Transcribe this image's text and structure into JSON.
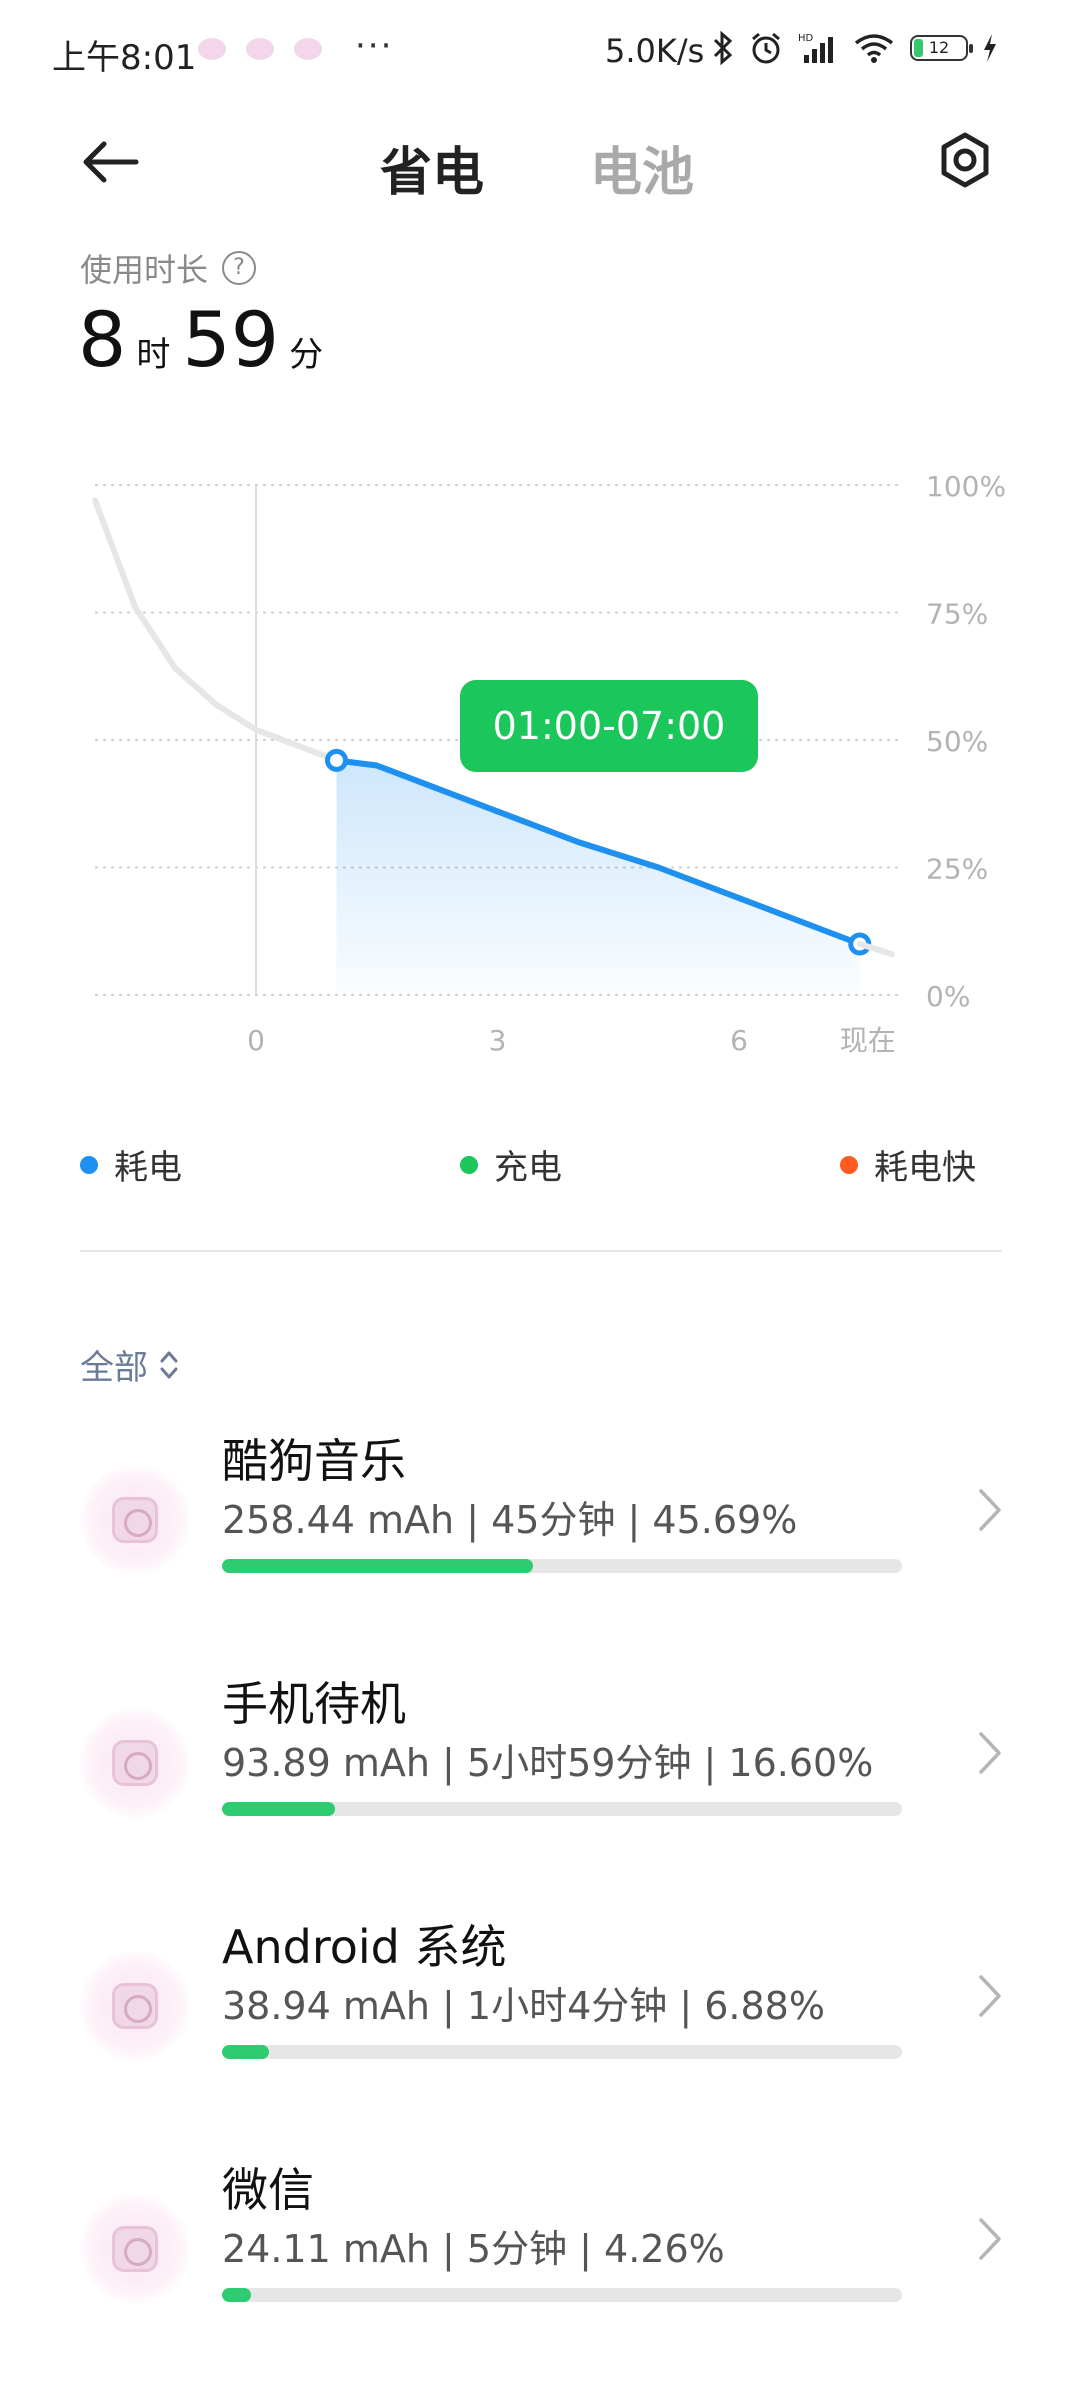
{
  "status_bar": {
    "time": "上午8:01",
    "more": "···",
    "net_speed": "5.0K/s",
    "battery_level": "12"
  },
  "header": {
    "tab_active": "省电",
    "tab_inactive": "电池"
  },
  "usage": {
    "label": "使用时长",
    "help": "?",
    "hours": "8",
    "hours_unit": "时",
    "minutes": "59",
    "minutes_unit": "分"
  },
  "chart_data": {
    "type": "line",
    "x_ticks": [
      "0",
      "3",
      "6",
      "现在"
    ],
    "y_ticks": [
      "100%",
      "75%",
      "50%",
      "25%",
      "0%"
    ],
    "ylim": [
      0,
      100
    ],
    "xlim": [
      -2,
      8
    ],
    "grid": true,
    "series": [
      {
        "values_x": [
          -2,
          -1.5,
          -1,
          -0.5,
          0,
          0.5,
          1
        ],
        "values_y": [
          97,
          76,
          64,
          57,
          52,
          49,
          46
        ],
        "style": "grey"
      },
      {
        "values_x": [
          1,
          1.5,
          2,
          3,
          4,
          5,
          6,
          7.5
        ],
        "values_y": [
          46,
          45,
          42,
          36,
          30,
          25,
          19,
          10
        ],
        "style": "highlight"
      },
      {
        "values_x": [
          7.5,
          7.9
        ],
        "values_y": [
          10,
          8
        ],
        "style": "grey"
      }
    ],
    "tooltip": "01:00-07:00"
  },
  "legend": {
    "items": [
      {
        "label": "耗电",
        "color": "#1e90f0"
      },
      {
        "label": "充电",
        "color": "#1bc65a"
      },
      {
        "label": "耗电快",
        "color": "#ff5a1f"
      }
    ]
  },
  "filter": {
    "label": "全部"
  },
  "apps": [
    {
      "name": "酷狗音乐",
      "stats": "258.44 mAh | 45分钟 | 45.69%",
      "percent": 45.69
    },
    {
      "name": "手机待机",
      "stats": "93.89 mAh | 5小时59分钟 | 16.60%",
      "percent": 16.6
    },
    {
      "name": "Android 系统",
      "stats": "38.94 mAh | 1小时4分钟 | 6.88%",
      "percent": 6.88
    },
    {
      "name": "微信",
      "stats": "24.11 mAh | 5分钟 | 4.26%",
      "percent": 4.26
    }
  ]
}
